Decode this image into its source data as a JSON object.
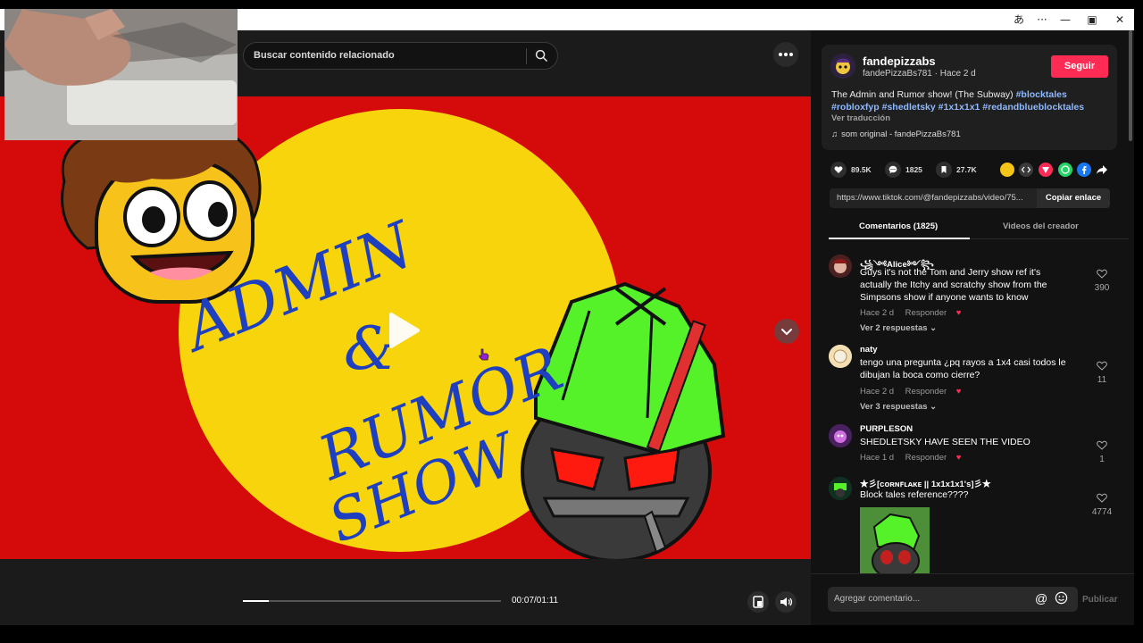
{
  "window": {
    "translate_icon": "あ",
    "more": "···",
    "minimize": "—",
    "restore": "▣",
    "close": "✕"
  },
  "search": {
    "placeholder": "Buscar contenido relacionado"
  },
  "player": {
    "time": "00:07/01:11",
    "progress": 0.1
  },
  "video_text": {
    "line1": "ADMIN",
    "line2": "&",
    "line3": "RUMOR",
    "line4": "SHOW"
  },
  "author": {
    "name": "fandepizzabs",
    "sub": "fandePizzaBs781 · Hace 2 d",
    "follow": "Seguir",
    "desc_text": "The Admin and Rumor show! (The Subway) ",
    "tags": [
      "#blocktales",
      "#robloxfyp",
      "#shedletsky",
      "#1x1x1x1",
      "#redandblueblocktales"
    ],
    "translate": "Ver traducción",
    "sound": "som original - fandePizzaBs781"
  },
  "stats": {
    "likes": "89.5K",
    "comments": "1825",
    "saves": "27.7K"
  },
  "link": {
    "url": "https://www.tiktok.com/@fandepizzabs/video/75...",
    "copy": "Copiar enlace"
  },
  "tabs": {
    "comments": "Comentarios (1825)",
    "creator": "Videos del creador"
  },
  "comments": [
    {
      "name": "꧁༺Alice༻꧂",
      "text": "Guys it's not the Tom and Jerry show ref it's actually the Itchy and scratchy show from the Simpsons show if anyone wants to know",
      "time": "Hace 2 d",
      "reply": "Responder",
      "replies": "Ver 2 respuestas",
      "likes": "390"
    },
    {
      "name": "naty",
      "text": "tengo una pregunta ¿pq rayos a 1x4 casi todos le dibujan la boca como cierre?",
      "time": "Hace 2 d",
      "reply": "Responder",
      "replies": "Ver 3 respuestas",
      "likes": "11"
    },
    {
      "name": "PURPLESON",
      "text": "SHEDLETSKY HAVE SEEN THE VIDEO",
      "time": "Hace 1 d",
      "reply": "Responder",
      "likes": "1"
    },
    {
      "name": "★彡[ᴄᴏʀɴꜰʟᴀᴋᴇ || 1x1x1x1's]彡★",
      "text": "Block tales reference????",
      "likes": "4774"
    }
  ],
  "footer": {
    "placeholder": "Agregar comentario...",
    "publish": "Publicar"
  },
  "colors": {
    "accent": "#fe2c55",
    "tag": "#8eb9ff",
    "video_bg": "#d50a0a"
  }
}
